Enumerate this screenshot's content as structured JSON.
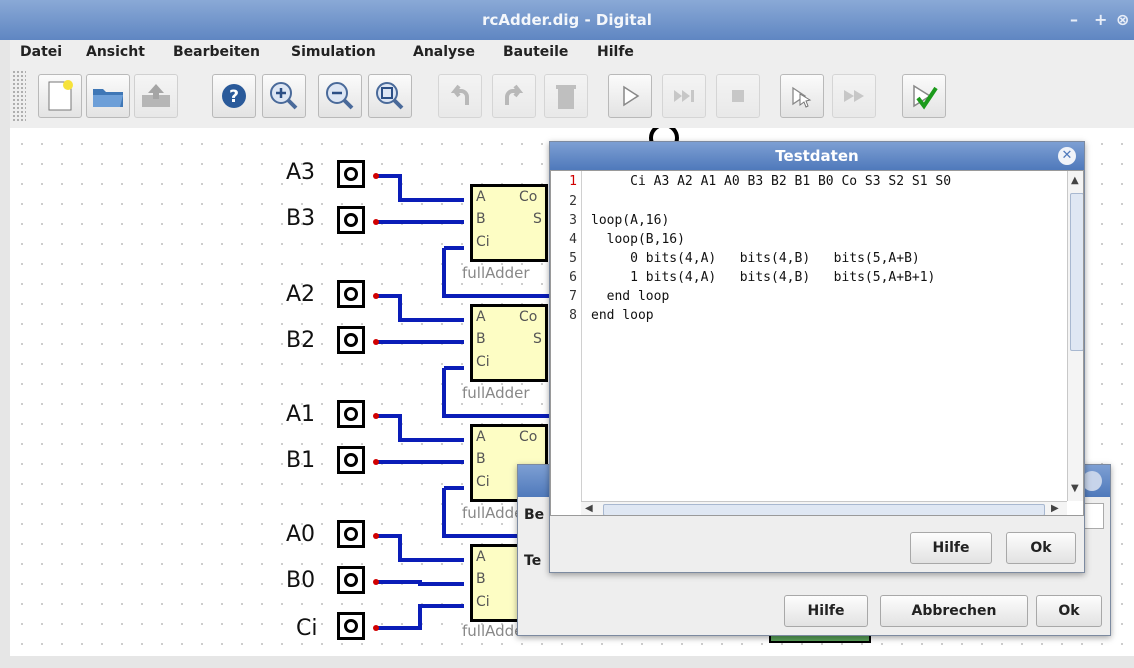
{
  "window": {
    "title": "rcAdder.dig - Digital",
    "controls": [
      "–",
      "+",
      "⊗"
    ]
  },
  "menu": [
    "Datei",
    "Ansicht",
    "Bearbeiten",
    "Simulation",
    "Analyse",
    "Bauteile",
    "Hilfe"
  ],
  "toolbar": {
    "icons": [
      "new-file-icon",
      "open-folder-icon",
      "save-icon",
      "help-icon",
      "zoom-in-icon",
      "zoom-out-icon",
      "zoom-fit-icon",
      "undo-icon",
      "redo-icon",
      "delete-icon",
      "run-icon",
      "step-icon",
      "stop-icon",
      "gate-step-icon",
      "fast-forward-icon",
      "test-check-icon"
    ]
  },
  "circuit": {
    "pins": [
      "A3",
      "B3",
      "A2",
      "B2",
      "A1",
      "B1",
      "A0",
      "B0",
      "Ci"
    ],
    "adder": {
      "name": "fullAdder",
      "in_a": "A",
      "in_b": "B",
      "in_ci": "Ci",
      "out_co": "Co",
      "out_s": "S"
    }
  },
  "testdata_dialog": {
    "title": "Testdaten",
    "lines": [
      {
        "n": "1",
        "text": "     Ci A3 A2 A1 A0 B3 B2 B1 B0 Co S3 S2 S1 S0"
      },
      {
        "n": "2",
        "text": ""
      },
      {
        "n": "3",
        "text": "loop(A,16)"
      },
      {
        "n": "4",
        "text": "  loop(B,16)"
      },
      {
        "n": "5",
        "text": "     0 bits(4,A)   bits(4,B)   bits(5,A+B)"
      },
      {
        "n": "6",
        "text": "     1 bits(4,A)   bits(4,B)   bits(5,A+B+1)"
      },
      {
        "n": "7",
        "text": "  end loop"
      },
      {
        "n": "8",
        "text": "end loop"
      }
    ],
    "buttons": {
      "help": "Hilfe",
      "ok": "Ok"
    }
  },
  "back_dialog": {
    "label1": "Be",
    "label2": "Te",
    "buttons": {
      "help": "Hilfe",
      "cancel": "Abbrechen",
      "ok": "Ok"
    }
  },
  "colors": {
    "wire": "#0a1db8",
    "adder_fill": "#fdfdc4",
    "title_blue": "#5f86c2",
    "line1_number": "#d00000"
  }
}
